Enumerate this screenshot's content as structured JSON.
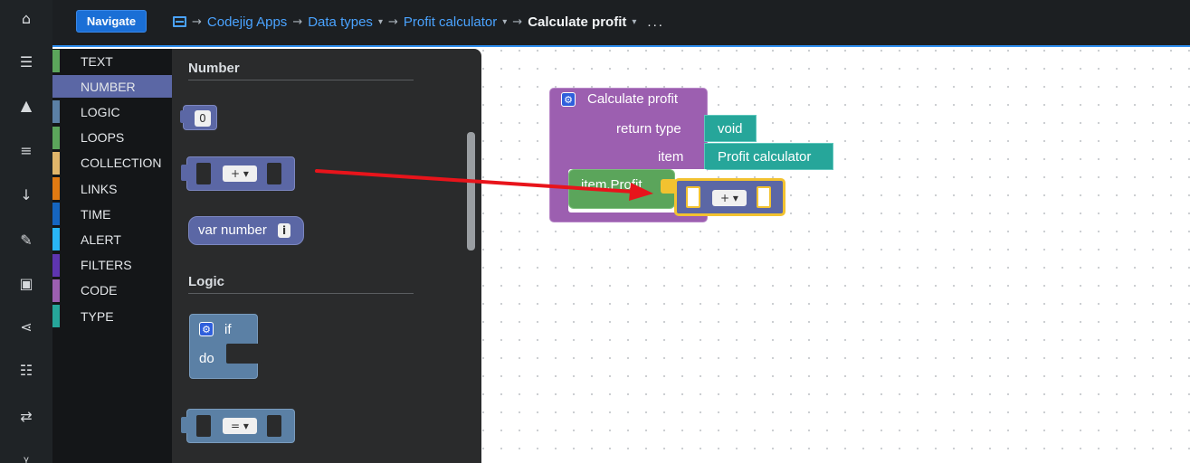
{
  "rail": {
    "icons": [
      "home-icon",
      "database-icon",
      "lock-icon",
      "menu-icon",
      "sort-numeric-icon",
      "pencil-icon",
      "archive-icon",
      "share-icon",
      "list-ordered-icon",
      "swap-icon",
      "code-branch-icon"
    ],
    "glyphs": [
      "⌂",
      "☰",
      "▲",
      "≡",
      "↓",
      "✎",
      "▣",
      "⋖",
      "☷",
      "⇄",
      "ᵞ"
    ]
  },
  "header": {
    "navigate_label": "Navigate",
    "breadcrumbs": [
      "Codejig Apps",
      "Data types",
      "Profit calculator",
      "Calculate profit"
    ],
    "arrow": "→",
    "caret": "▾",
    "more": "...",
    "accent": "#2e8ef0"
  },
  "categories": [
    {
      "label": "TEXT",
      "color": "#5ba55b"
    },
    {
      "label": "NUMBER",
      "color": "#5b67a5",
      "selected": true
    },
    {
      "label": "LOGIC",
      "color": "#5b80a5"
    },
    {
      "label": "LOOPS",
      "color": "#5ba55b"
    },
    {
      "label": "COLLECTION",
      "color": "#e0b56a"
    },
    {
      "label": "LINKS",
      "color": "#e07a12"
    },
    {
      "label": "TIME",
      "color": "#1565c0"
    },
    {
      "label": "ALERT",
      "color": "#29b6f6"
    },
    {
      "label": "FILTERS",
      "color": "#5e35b1"
    },
    {
      "label": "CODE",
      "color": "#9c5fb0"
    },
    {
      "label": "TYPE",
      "color": "#26a69a"
    }
  ],
  "flyout": {
    "number_title": "Number",
    "logic_title": "Logic",
    "number_value": "0",
    "plus_op": "+ ▾",
    "var_number_label": "var number",
    "info_glyph": "i",
    "if_label": "if",
    "do_label": "do",
    "equals_op": "= ▾"
  },
  "workspace": {
    "function_title": "Calculate profit",
    "return_type_label": "return type",
    "return_type_value": "void",
    "item_label": "item",
    "item_value": "Profit calculator",
    "field_block": "item.Profit",
    "plus_op": "+ ▾",
    "arrow_color": "#e8141b"
  }
}
